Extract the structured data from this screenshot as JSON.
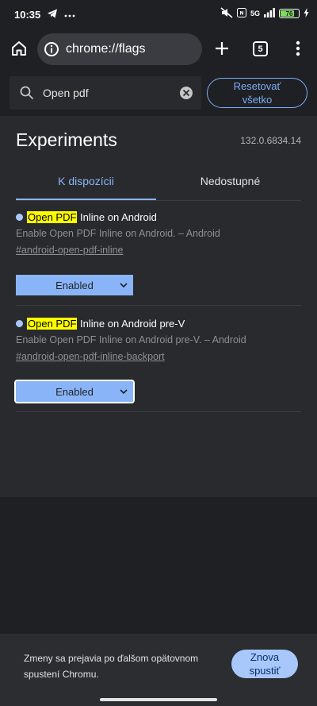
{
  "status_bar": {
    "time": "10:35",
    "icons": [
      "telegram-icon",
      "more-dots-icon",
      "mute-icon",
      "nfc-icon",
      "signal-icon",
      "battery-icon",
      "charging-icon"
    ],
    "network_label": "5G",
    "battery_level": "76"
  },
  "toolbar": {
    "url": "chrome://flags",
    "tab_count": "5"
  },
  "search": {
    "value": "Open pdf",
    "reset_label_line1": "Resetovať",
    "reset_label_line2": "všetko"
  },
  "header": {
    "title": "Experiments",
    "version": "132.0.6834.14"
  },
  "tabs": [
    {
      "label": "K dispozícii",
      "active": true
    },
    {
      "label": "Nedostupné",
      "active": false
    }
  ],
  "flags": [
    {
      "highlight": "Open PDF",
      "title_rest": " Inline on Android",
      "description": "Enable Open PDF Inline on Android. – Android",
      "link": "#android-open-pdf-inline",
      "value": "Enabled"
    },
    {
      "highlight": "Open PDF",
      "title_rest": " Inline on Android pre-V",
      "description": "Enable Open PDF Inline on Android pre-V. – Android",
      "link": "#android-open-pdf-inline-backport",
      "value": "Enabled"
    }
  ],
  "restart": {
    "message": "Zmeny sa prejavia po ďalšom opätovnom spustení Chromu.",
    "button_line1": "Znova",
    "button_line2": "spustiť"
  },
  "colors": {
    "accent": "#8ab4f8",
    "highlight": "#ffff00",
    "background": "#1f2023",
    "panel": "#292a2d"
  }
}
